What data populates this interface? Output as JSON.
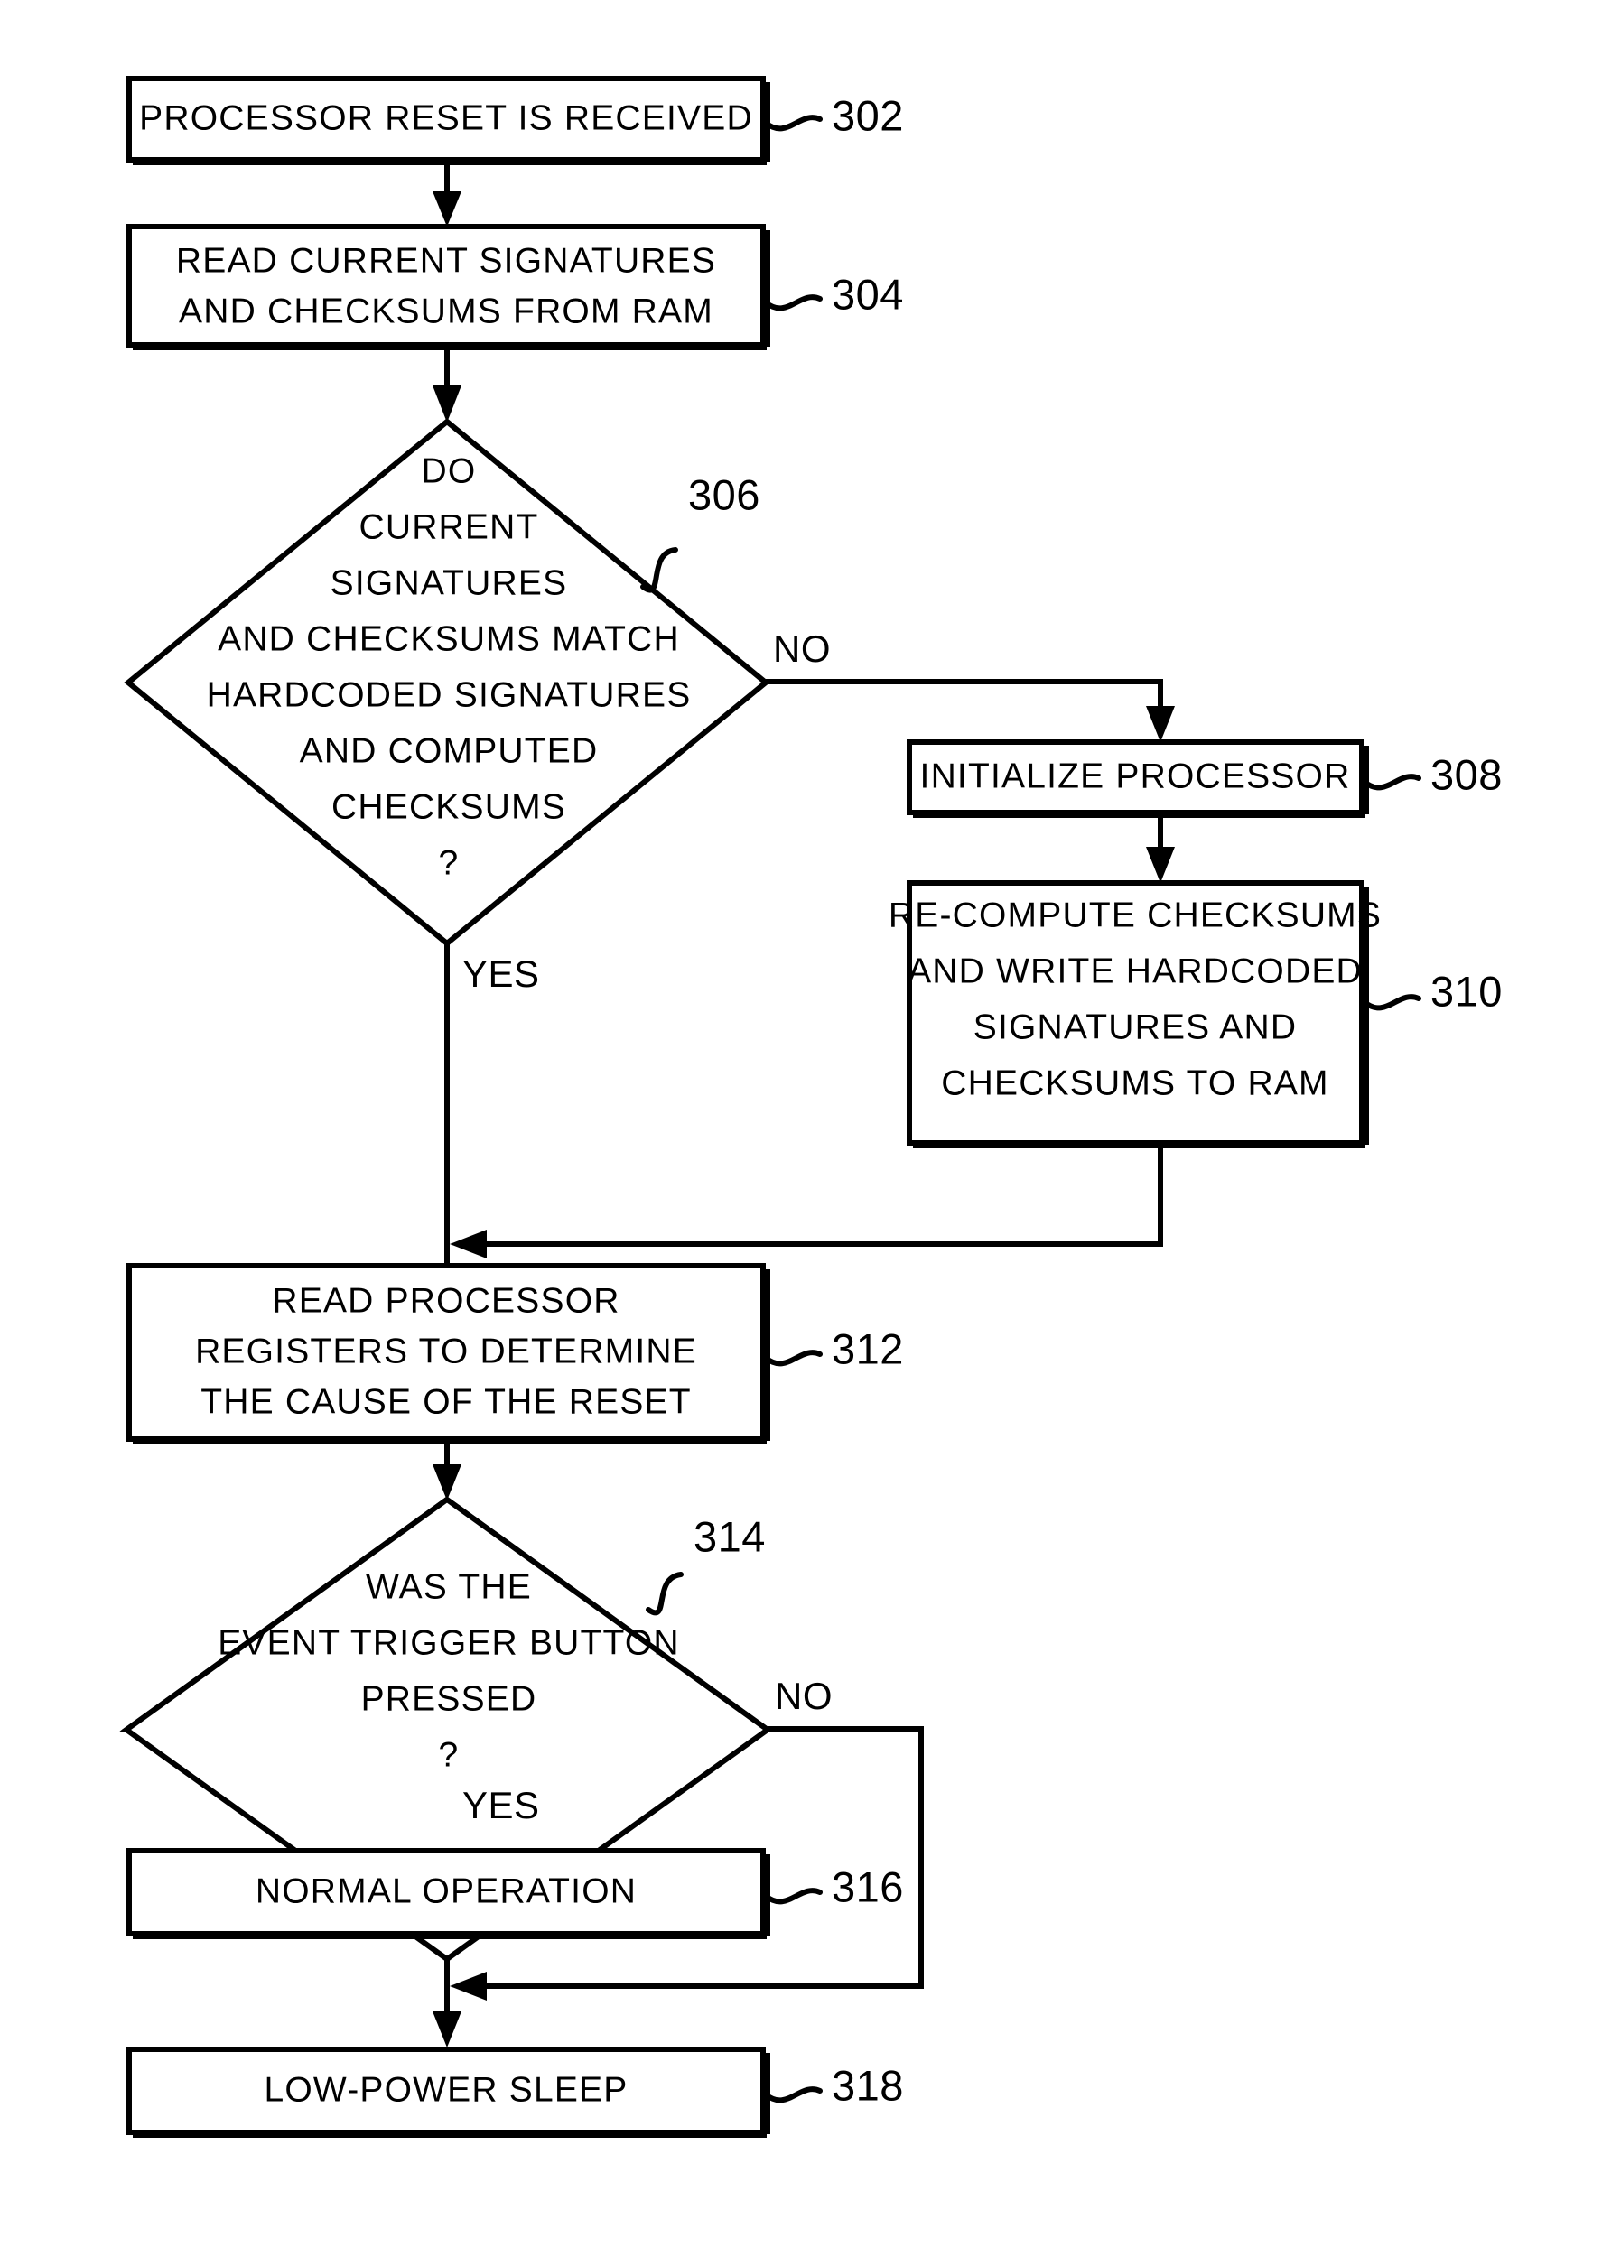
{
  "figure": {
    "type": "patent-flowchart",
    "background": "#ffffff",
    "ink": "#000000"
  },
  "nodes": [
    {
      "id": "n302",
      "shape": "process",
      "ref": "302",
      "lines": [
        "PROCESSOR RESET IS RECEIVED"
      ]
    },
    {
      "id": "n304",
      "shape": "process",
      "ref": "304",
      "lines": [
        "READ CURRENT SIGNATURES",
        "AND CHECKSUMS FROM RAM"
      ]
    },
    {
      "id": "n306",
      "shape": "decision",
      "ref": "306",
      "lines": [
        "DO",
        "CURRENT",
        "SIGNATURES",
        "AND CHECKSUMS MATCH",
        "HARDCODED SIGNATURES",
        "AND COMPUTED",
        "CHECKSUMS",
        "?"
      ]
    },
    {
      "id": "n308",
      "shape": "process",
      "ref": "308",
      "lines": [
        "INITIALIZE PROCESSOR"
      ]
    },
    {
      "id": "n310",
      "shape": "process",
      "ref": "310",
      "lines": [
        "RE-COMPUTE CHECKSUMS",
        "AND WRITE HARDCODED",
        "SIGNATURES AND",
        "CHECKSUMS TO RAM"
      ]
    },
    {
      "id": "n312",
      "shape": "process",
      "ref": "312",
      "lines": [
        "READ PROCESSOR",
        "REGISTERS TO DETERMINE",
        "THE CAUSE OF THE RESET"
      ]
    },
    {
      "id": "n314",
      "shape": "decision",
      "ref": "314",
      "lines": [
        "WAS THE",
        "EVENT TRIGGER BUTTON",
        "PRESSED",
        "?"
      ]
    },
    {
      "id": "n316",
      "shape": "process",
      "ref": "316",
      "lines": [
        "NORMAL OPERATION"
      ]
    },
    {
      "id": "n318",
      "shape": "process",
      "ref": "318",
      "lines": [
        "LOW-POWER SLEEP"
      ]
    }
  ],
  "branch_labels": {
    "d306_no": "NO",
    "d306_yes": "YES",
    "d314_no": "NO",
    "d314_yes": "YES"
  },
  "text": {
    "n302_l0": "PROCESSOR RESET IS RECEIVED",
    "n302_ref": "302",
    "n304_l0": "READ CURRENT SIGNATURES",
    "n304_l1": "AND CHECKSUMS FROM RAM",
    "n304_ref": "304",
    "n306_l0": "DO",
    "n306_l1": "CURRENT",
    "n306_l2": "SIGNATURES",
    "n306_l3": "AND CHECKSUMS MATCH",
    "n306_l4": "HARDCODED SIGNATURES",
    "n306_l5": "AND COMPUTED",
    "n306_l6": "CHECKSUMS",
    "n306_l7": "?",
    "n306_ref": "306",
    "n308_l0": "INITIALIZE PROCESSOR",
    "n308_ref": "308",
    "n310_l0": "RE-COMPUTE CHECKSUMS",
    "n310_l1": "AND WRITE HARDCODED",
    "n310_l2": "SIGNATURES AND",
    "n310_l3": "CHECKSUMS TO RAM",
    "n310_ref": "310",
    "n312_l0": "READ PROCESSOR",
    "n312_l1": "REGISTERS TO DETERMINE",
    "n312_l2": "THE CAUSE OF THE RESET",
    "n312_ref": "312",
    "n314_l0": "WAS THE",
    "n314_l1": "EVENT TRIGGER BUTTON",
    "n314_l2": "PRESSED",
    "n314_l3": "?",
    "n314_ref": "314",
    "n316_l0": "NORMAL OPERATION",
    "n316_ref": "316",
    "n318_l0": "LOW-POWER SLEEP",
    "n318_ref": "318",
    "no_306": "NO",
    "yes_306": "YES",
    "no_314": "NO",
    "yes_314": "YES"
  }
}
